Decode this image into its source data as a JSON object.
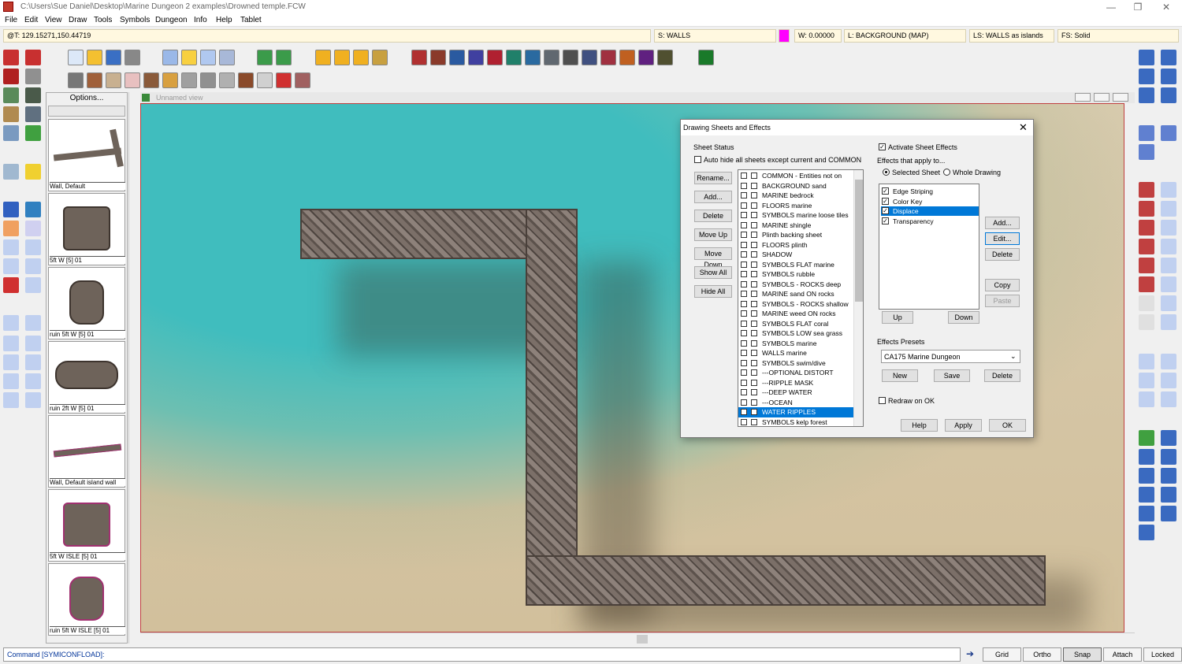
{
  "window": {
    "title": "C:\\Users\\Sue Daniel\\Desktop\\Marine Dungeon 2 examples\\Drowned temple.FCW",
    "minimize": "—",
    "maximize": "❐",
    "close": "✕"
  },
  "menu": [
    "File",
    "Edit",
    "View",
    "Draw",
    "Tools",
    "Symbols",
    "Dungeon",
    "Info",
    "Help",
    "Tablet"
  ],
  "status": {
    "coords": "@T: 129.15271,150.44719",
    "sheet": "S: WALLS",
    "width": "W: 0.00000",
    "layer": "L: BACKGROUND (MAP)",
    "linestyle": "LS: WALLS as islands",
    "fillstyle": "FS: Solid",
    "color": "#ff00ff"
  },
  "symbols": {
    "options": "Options...",
    "items": [
      "Wall, Default",
      "5ft W [5] 01",
      "ruin 5ft W [5] 01",
      "ruin 2ft W [5] 01",
      "Wall, Default island wall",
      "5ft W ISLE [5] 01",
      "ruin 5ft W ISLE [5] 01"
    ]
  },
  "view": {
    "title": "Unnamed view"
  },
  "dialog": {
    "title": "Drawing Sheets and Effects",
    "sheet_status": "Sheet Status",
    "auto_hide": "Auto hide all sheets except current and COMMON",
    "buttons_left": [
      "Rename...",
      "Add...",
      "Delete",
      "Move Up",
      "Move Down",
      "Show All",
      "Hide All"
    ],
    "sheets": [
      "COMMON - Entities not on",
      "BACKGROUND sand",
      "MARINE bedrock",
      "FLOORS marine",
      "SYMBOLS marine loose tiles",
      "MARINE shingle",
      "Plinth backing sheet",
      "FLOORS plinth",
      "SHADOW",
      "SYMBOLS FLAT marine",
      "SYMBOLS rubble",
      "SYMBOLS - ROCKS deep",
      "MARINE sand ON rocks",
      "SYMBOLS - ROCKS shallow",
      "MARINE weed ON rocks",
      "SYMBOLS FLAT coral",
      "SYMBOLS LOW sea grass",
      "SYMBOLS marine",
      "WALLS marine",
      "SYMBOLS swim/dive",
      "---OPTIONAL DISTORT",
      "---RIPPLE MASK",
      "---DEEP WATER",
      "---OCEAN",
      "WATER RIPPLES",
      "SYMBOLS kelp forest"
    ],
    "selected_sheet": "WATER RIPPLES",
    "activate_effects": "Activate Sheet Effects",
    "effects_apply": "Effects that apply to...",
    "radio_selected": "Selected Sheet",
    "radio_whole": "Whole Drawing",
    "effects": [
      {
        "name": "Edge Striping",
        "checked": true
      },
      {
        "name": "Color Key",
        "checked": true
      },
      {
        "name": "Displace",
        "checked": true
      },
      {
        "name": "Transparency",
        "checked": true
      }
    ],
    "selected_effect": "Displace",
    "eff_buttons": [
      "Add...",
      "Edit...",
      "Delete",
      "Copy",
      "Paste"
    ],
    "up": "Up",
    "down": "Down",
    "presets_label": "Effects Presets",
    "preset_value": "CA175 Marine Dungeon",
    "preset_buttons": [
      "New",
      "Save",
      "Delete"
    ],
    "redraw": "Redraw on OK",
    "bottom_buttons": [
      "Help",
      "Apply",
      "OK"
    ]
  },
  "command": "Command [SYMICONFLOAD]:",
  "cmd_buttons": [
    "Grid",
    "Ortho",
    "Snap",
    "Attach",
    "Locked"
  ]
}
